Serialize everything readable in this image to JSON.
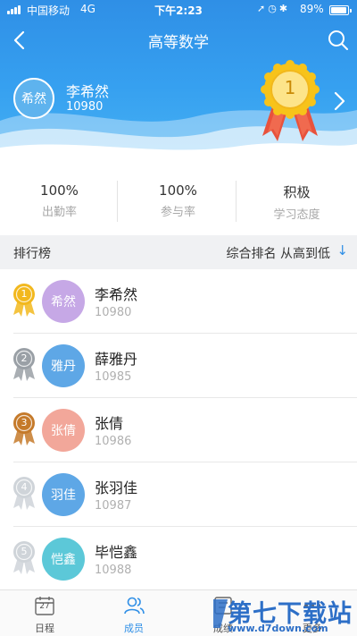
{
  "status_bar": {
    "carrier": "中国移动",
    "network": "4G",
    "time": "下午2:23",
    "battery": "89%"
  },
  "nav": {
    "title": "高等数学"
  },
  "me": {
    "avatar_text": "希然",
    "name": "李希然",
    "id": "10980",
    "rank": "1"
  },
  "stats": [
    {
      "value": "100%",
      "label": "出勤率"
    },
    {
      "value": "100%",
      "label": "参与率"
    },
    {
      "value": "积极",
      "label": "学习态度"
    }
  ],
  "ranking": {
    "title": "排行榜",
    "sort_label": "综合排名 从高到低",
    "sort_arrow": "↓"
  },
  "members": [
    {
      "rank": "1",
      "avatar_text": "希然",
      "name": "李希然",
      "id": "10980",
      "avatar_color": "#c6a8e6",
      "medal_color": "#f2b81d"
    },
    {
      "rank": "2",
      "avatar_text": "雅丹",
      "name": "薛雅丹",
      "id": "10985",
      "avatar_color": "#5ea7e6",
      "medal_color": "#9aa0a6"
    },
    {
      "rank": "3",
      "avatar_text": "张倩",
      "name": "张倩",
      "id": "10986",
      "avatar_color": "#f2a79a",
      "medal_color": "#c57a2a"
    },
    {
      "rank": "4",
      "avatar_text": "羽佳",
      "name": "张羽佳",
      "id": "10987",
      "avatar_color": "#5ea7e6",
      "medal_color": "#cfd4d9"
    },
    {
      "rank": "5",
      "avatar_text": "恺鑫",
      "name": "毕恺鑫",
      "id": "10988",
      "avatar_color": "#5cc8d8",
      "medal_color": "#cfd4d9"
    }
  ],
  "tabs": [
    {
      "label": "日程",
      "icon": "calendar-icon",
      "calendar_day": "27"
    },
    {
      "label": "成员",
      "icon": "members-icon"
    },
    {
      "label": "成绩",
      "icon": "grades-icon"
    },
    {
      "label": "更多",
      "icon": "more-icon"
    }
  ],
  "watermark": {
    "title": "第七下载站",
    "url": "www.d7down.com"
  }
}
